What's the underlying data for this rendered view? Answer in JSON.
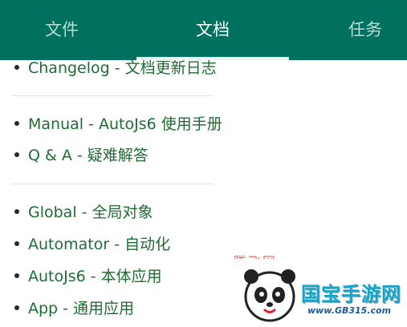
{
  "tabs": [
    {
      "label": "文件"
    },
    {
      "label": "文档"
    },
    {
      "label": "任务"
    }
  ],
  "doc_items": [
    {
      "label": "Changelog - 文档更新日志"
    },
    {
      "label": "Manual - AutoJs6 使用手册"
    },
    {
      "label": "Q & A - 疑难解答"
    },
    {
      "label": "Global - 全局对象"
    },
    {
      "label": "Automator - 自动化"
    },
    {
      "label": "AutoJs6 - 本体应用"
    },
    {
      "label": "App - 通用应用"
    }
  ],
  "watermark": {
    "overlay_text": "腾飞网",
    "site_name": "国宝手游网",
    "site_url": "www.GB315.com"
  },
  "colors": {
    "primary": "#00715e",
    "tab_inactive": "#b9ddd6",
    "link_green": "#1f6b33",
    "watermark_blue": "#14a4c9"
  }
}
